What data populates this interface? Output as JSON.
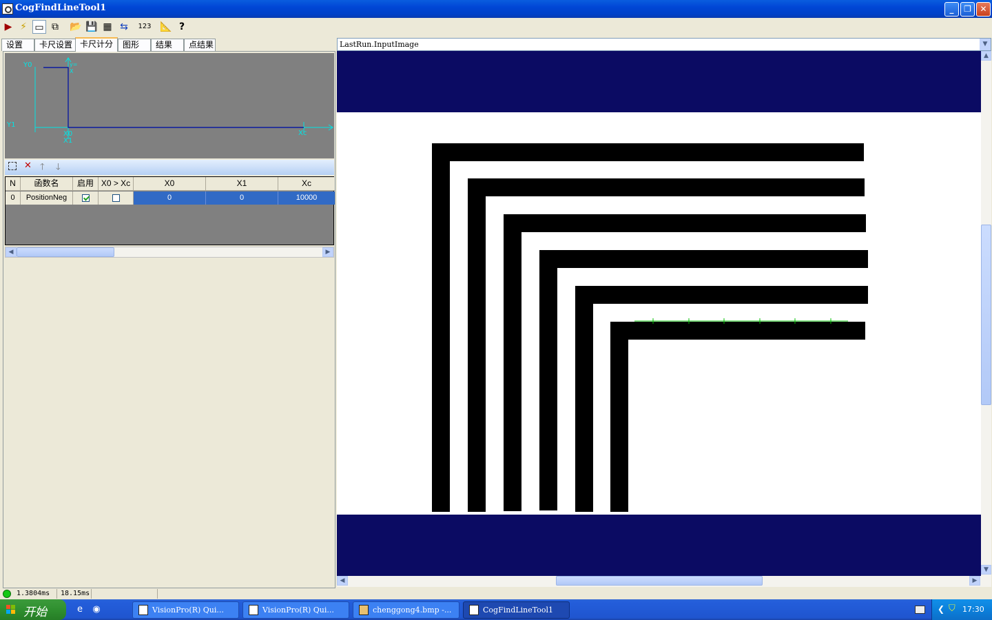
{
  "window": {
    "title": "CogFindLineTool1"
  },
  "toolbar": {
    "buttons": [
      "run-icon",
      "electric-icon",
      "display-icon",
      "copy-icon",
      "open-icon",
      "save-icon",
      "graphics-icon",
      "import-icon",
      "number-icon",
      "measure-icon",
      "help-icon"
    ]
  },
  "tabs": [
    "设置",
    "卡尺设置",
    "卡尺计分",
    "图形",
    "结果",
    "点结果"
  ],
  "active_tab": "卡尺计分",
  "diagram": {
    "labels": {
      "y0": "Y0",
      "y1": "Y1",
      "x0": "X0",
      "x1": "X1",
      "xc": "Xc",
      "y_axis_top": "y=",
      "x_axis_top": "X"
    }
  },
  "grid": {
    "columns": [
      "N",
      "函数名",
      "启用",
      "X0 > Xc",
      "X0",
      "X1",
      "Xc"
    ],
    "rows": [
      {
        "n": "0",
        "name": "PositionNeg",
        "enabled": true,
        "x0_gt_xc": false,
        "x0": "0",
        "x1": "0",
        "xc": "10000"
      }
    ]
  },
  "image_selector": {
    "value": "LastRun.InputImage"
  },
  "status": {
    "time1": "1.3804ms",
    "time2": "18.15ms",
    "status_color": "#14c814"
  },
  "taskbar": {
    "start_label": "开始",
    "tasks": [
      {
        "label": "VisionPro(R) Qui...",
        "active": false
      },
      {
        "label": "VisionPro(R) Qui...",
        "active": false
      },
      {
        "label": "chenggong4.bmp -...",
        "active": false
      },
      {
        "label": "CogFindLineTool1",
        "active": true
      }
    ],
    "clock": "17:30"
  },
  "colors": {
    "title_bar": "#0046d5",
    "image_band": "#0b0b63",
    "selection": "#316ac5",
    "caliper_line": "#00c000"
  }
}
